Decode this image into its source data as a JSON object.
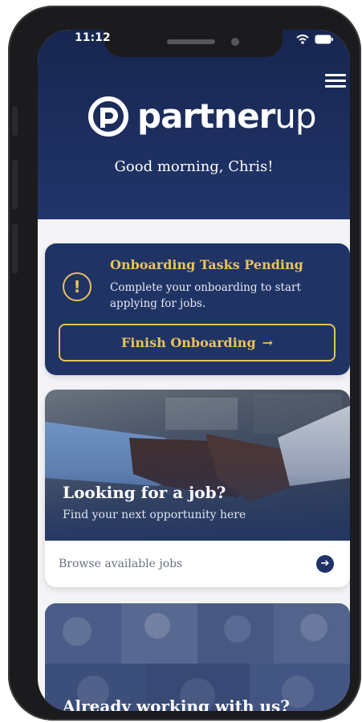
{
  "status_bar": {
    "time": "11:12"
  },
  "header": {
    "logo_bold": "partner",
    "logo_light": "up",
    "greeting": "Good morning, Chris!"
  },
  "onboarding": {
    "title": "Onboarding Tasks Pending",
    "message": "Complete your onboarding to start applying for jobs.",
    "button_label": "Finish Onboarding",
    "button_arrow": "→"
  },
  "job_card": {
    "title": "Looking for a job?",
    "subtitle": "Find your next opportunity here",
    "browse_label": "Browse available jobs",
    "browse_arrow": "➔"
  },
  "working_card": {
    "title": "Already working with us?"
  },
  "colors": {
    "brand_navy": "#1f3465",
    "accent_gold": "#e9c25a",
    "header_top": "#17264f"
  },
  "icons": {
    "menu": "hamburger-icon",
    "warning": "exclamation-circle-icon",
    "arrow": "arrow-right-icon",
    "wifi": "wifi-icon",
    "battery": "battery-icon"
  }
}
